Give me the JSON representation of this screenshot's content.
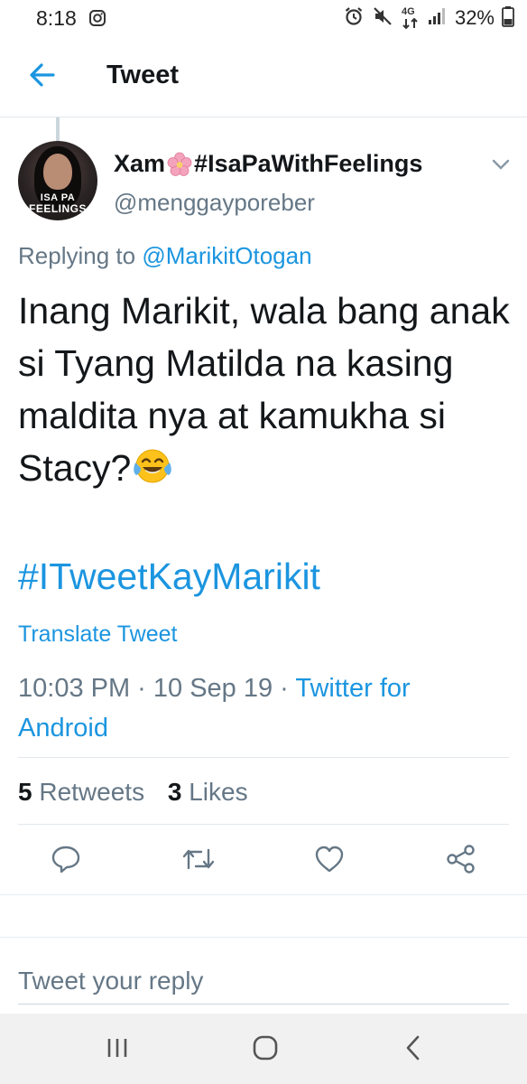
{
  "status_bar": {
    "time": "8:18",
    "network": "4G",
    "battery": "32%"
  },
  "header": {
    "title": "Tweet",
    "back_icon": "arrow-left-icon"
  },
  "tweet": {
    "avatar": {
      "line1": "ISA PA",
      "line2": "FEELINGS"
    },
    "display_name_prefix": "Xam",
    "display_name_suffix": "#IsaPaWithFeelings",
    "username": "@menggayporeber",
    "replying_prefix": "Replying to",
    "replying_handle": "@MarikitOtogan",
    "text": "Inang Marikit, wala bang anak si Tyang Matilda na kasing maldita nya at kamukha si Stacy?",
    "hashtag": "#ITweetKayMarikit",
    "translate_label": "Translate Tweet",
    "timestamp": "10:03 PM · 10 Sep 19 · ",
    "source": "Twitter for Android",
    "retweets_count": "5",
    "retweets_label": "Retweets",
    "likes_count": "3",
    "likes_label": "Likes"
  },
  "reply": {
    "placeholder": "Tweet your reply"
  },
  "colors": {
    "accent": "#1b95e0",
    "secondary_text": "#657786",
    "primary_text": "#14171a",
    "divider": "#e1e8ed"
  }
}
